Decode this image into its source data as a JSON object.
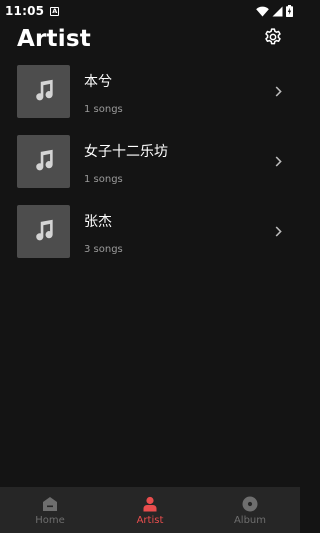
{
  "status_bar": {
    "time": "11:05",
    "notification_badge": "A",
    "icons": [
      "wifi-icon",
      "signal-icon",
      "battery-charging-icon"
    ]
  },
  "header": {
    "title": "Artist",
    "settings_icon": "gear-icon"
  },
  "artists": [
    {
      "name": "本兮",
      "count": "1 songs",
      "artwork_icon": "music-note-icon"
    },
    {
      "name": "女子十二乐坊",
      "count": "1 songs",
      "artwork_icon": "music-note-icon"
    },
    {
      "name": "张杰",
      "count": "3 songs",
      "artwork_icon": "music-note-icon"
    }
  ],
  "bottom_nav": {
    "items": [
      {
        "label": "Home",
        "icon": "home-icon",
        "active": false
      },
      {
        "label": "Artist",
        "icon": "person-icon",
        "active": true
      },
      {
        "label": "Album",
        "icon": "disc-icon",
        "active": false
      }
    ]
  },
  "colors": {
    "background": "#141414",
    "nav_background": "#262626",
    "artwork_background": "#4d4d4d",
    "accent": "#e84d4d",
    "inactive": "#6e6e6e",
    "secondary_text": "#9b9b9b"
  }
}
